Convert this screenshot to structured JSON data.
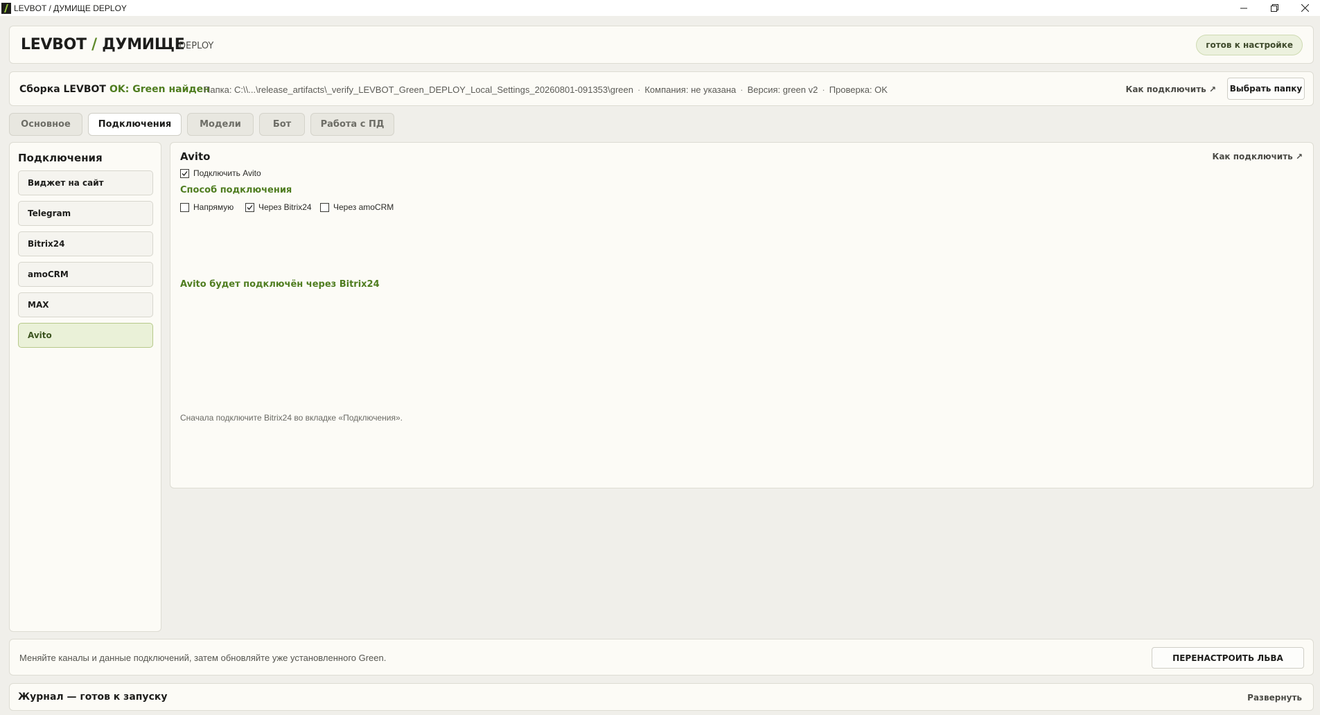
{
  "window": {
    "title": "LEVBOT / ДУМИЩЕ DEPLOY"
  },
  "header": {
    "brand_main": "LEVBOT",
    "brand_slash": " / ",
    "brand_second": "ДУМИЩЕ",
    "brand_sub": "DEPLOY",
    "status_badge": "готов к настройке"
  },
  "build": {
    "label": "Сборка LEVBOT",
    "status": "OK: Green найден",
    "folder": "Папка: C:\\\\...\\release_artifacts\\_verify_LEVBOT_Green_DEPLOY_Local_Settings_20260801-091353\\green",
    "company": "Компания: не указана",
    "version": "Версия: green v2",
    "check": "Проверка: OK",
    "separator": "·",
    "howto_link": "Как подключить ↗",
    "choose_folder_button": "Выбрать папку"
  },
  "tabs": [
    {
      "label": "Основное",
      "active": false
    },
    {
      "label": "Подключения",
      "active": true
    },
    {
      "label": "Модели",
      "active": false
    },
    {
      "label": "Бот",
      "active": false
    },
    {
      "label": "Работа с ПД",
      "active": false
    }
  ],
  "sidebar": {
    "title": "Подключения",
    "items": [
      {
        "label": "Виджет на сайт",
        "active": false
      },
      {
        "label": "Telegram",
        "active": false
      },
      {
        "label": "Bitrix24",
        "active": false
      },
      {
        "label": "amoCRM",
        "active": false
      },
      {
        "label": "MAX",
        "active": false
      },
      {
        "label": "Avito",
        "active": true
      }
    ]
  },
  "main": {
    "title": "Avito",
    "howto_link": "Как подключить ↗",
    "enable_checkbox": {
      "label": "Подключить Avito",
      "checked": true
    },
    "method_title": "Способ подключения",
    "methods": [
      {
        "label": "Напрямую",
        "checked": false
      },
      {
        "label": "Через Bitrix24",
        "checked": true
      },
      {
        "label": "Через amoCRM",
        "checked": false
      }
    ],
    "status_message": "Avito будет подключён через Bitrix24",
    "hint": "Сначала подключите Bitrix24 во вкладке «Подключения»."
  },
  "footer": {
    "text": "Меняйте каналы и данные подключений, затем обновляйте уже установленного Green.",
    "reconfigure_button": "ПЕРЕНАСТРОИТЬ ЛЬВА"
  },
  "journal": {
    "title": "Журнал — готов к запуску",
    "expand_link": "Развернуть"
  },
  "colors": {
    "accent_green": "#4f7d20",
    "background": "#f0efea",
    "card": "#fcfbf6"
  }
}
